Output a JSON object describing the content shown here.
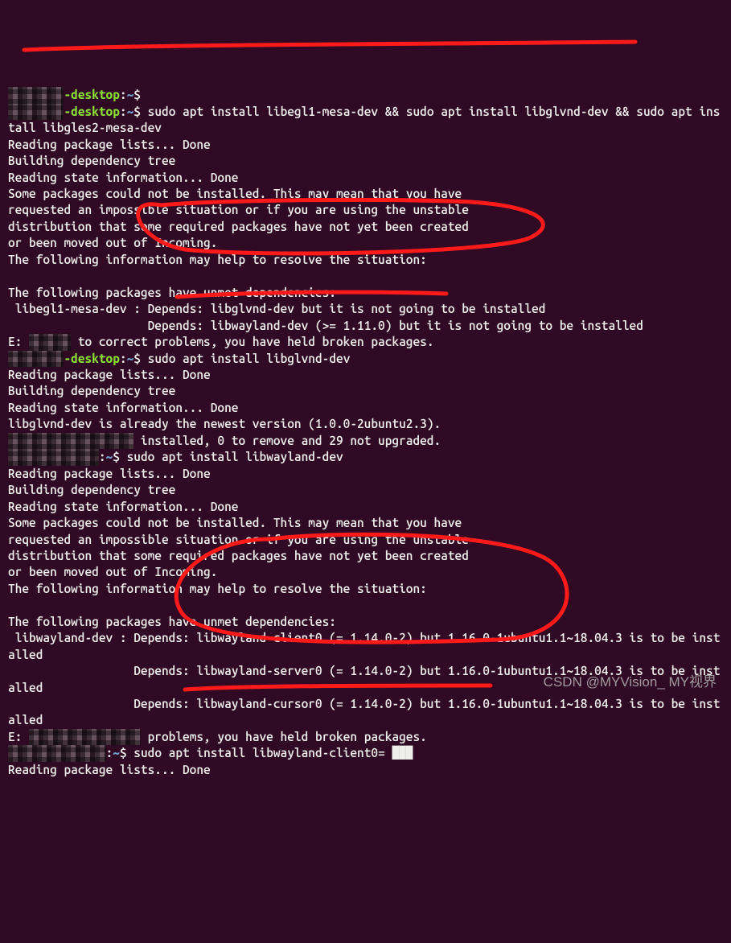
{
  "prompts": [
    {
      "user_hidden": true,
      "user": "████████",
      "host": "-desktop",
      "path": "~",
      "command": ""
    },
    {
      "user_hidden": true,
      "user": "████████",
      "host": "-desktop",
      "path": "~",
      "command": "sudo apt install libegl1-mesa-dev && sudo apt install libglvnd-dev && sudo apt install libgles2-mesa-dev"
    }
  ],
  "out_block_1": [
    "Reading package lists... Done",
    "Building dependency tree",
    "Reading state information... Done",
    "Some packages could not be installed. This may mean that you have",
    "requested an impossible situation or if you are using the unstable",
    "distribution that some required packages have not yet been created",
    "or been moved out of Incoming.",
    "The following information may help to resolve the situation:",
    "",
    "The following packages have unmet dependencies:",
    " libegl1-mesa-dev : Depends: libglvnd-dev but it is not going to be installed",
    "                    Depends: libwayland-dev (>= 1.11.0) but it is not going to be installed"
  ],
  "fix_line_1_prefix": "E: ",
  "fix_line_1_hidden": "██████",
  "fix_line_1_suffix": " to correct problems, you have held broken packages.",
  "prompt2": {
    "user_hidden": true,
    "user": "████████",
    "host": "-desktop",
    "path": "~",
    "command": "sudo apt install libglvnd-dev"
  },
  "out_block_2": [
    "Reading package lists... Done",
    "Building dependency tree",
    "Reading state information... Done",
    "libglvnd-dev is already the newest version (1.0.0-2ubuntu2.3).",
    "0 upgraded, 0 newly installed, 0 to remove and 29 not upgraded."
  ],
  "upgraded_line_hidden_prefix": "██████████████████",
  "upgraded_line_suffix": " installed, 0 to remove and 29 not upgraded.",
  "prompt3": {
    "user_hidden": true,
    "user": "█████████████",
    "host": "",
    "path": "~",
    "command": "sudo apt install libwayland-dev"
  },
  "out_block_3": [
    "Reading package lists... Done",
    "Building dependency tree",
    "Reading state information... Done",
    "Some packages could not be installed. This may mean that you have",
    "requested an impossible situation or if you are using the unstable",
    "distribution that some required packages have not yet been created",
    "or been moved out of Incoming.",
    "The following information may help to resolve the situation:",
    "",
    "The following packages have unmet dependencies:",
    " libwayland-dev : Depends: libwayland-client0 (= 1.14.0-2) but 1.16.0-1ubuntu1.1~18.04.3 is to be installed",
    "                  Depends: libwayland-server0 (= 1.14.0-2) but 1.16.0-1ubuntu1.1~18.04.3 is to be installed",
    "                  Depends: libwayland-cursor0 (= 1.14.0-2) but 1.16.0-1ubuntu1.1~18.04.3 is to be installed"
  ],
  "fix_line_2_prefix": "E: ",
  "fix_line_2_hidden": "████████████████",
  "fix_line_2_suffix": " problems, you have held broken packages.",
  "prompt4": {
    "user_hidden": true,
    "user": "██████████████",
    "host": "",
    "path": "~",
    "command": "sudo apt install libwayland-client0= ███"
  },
  "out_block_4": [
    "Reading package lists... Done"
  ],
  "watermark": "CSDN @MYVision_ MY视界"
}
